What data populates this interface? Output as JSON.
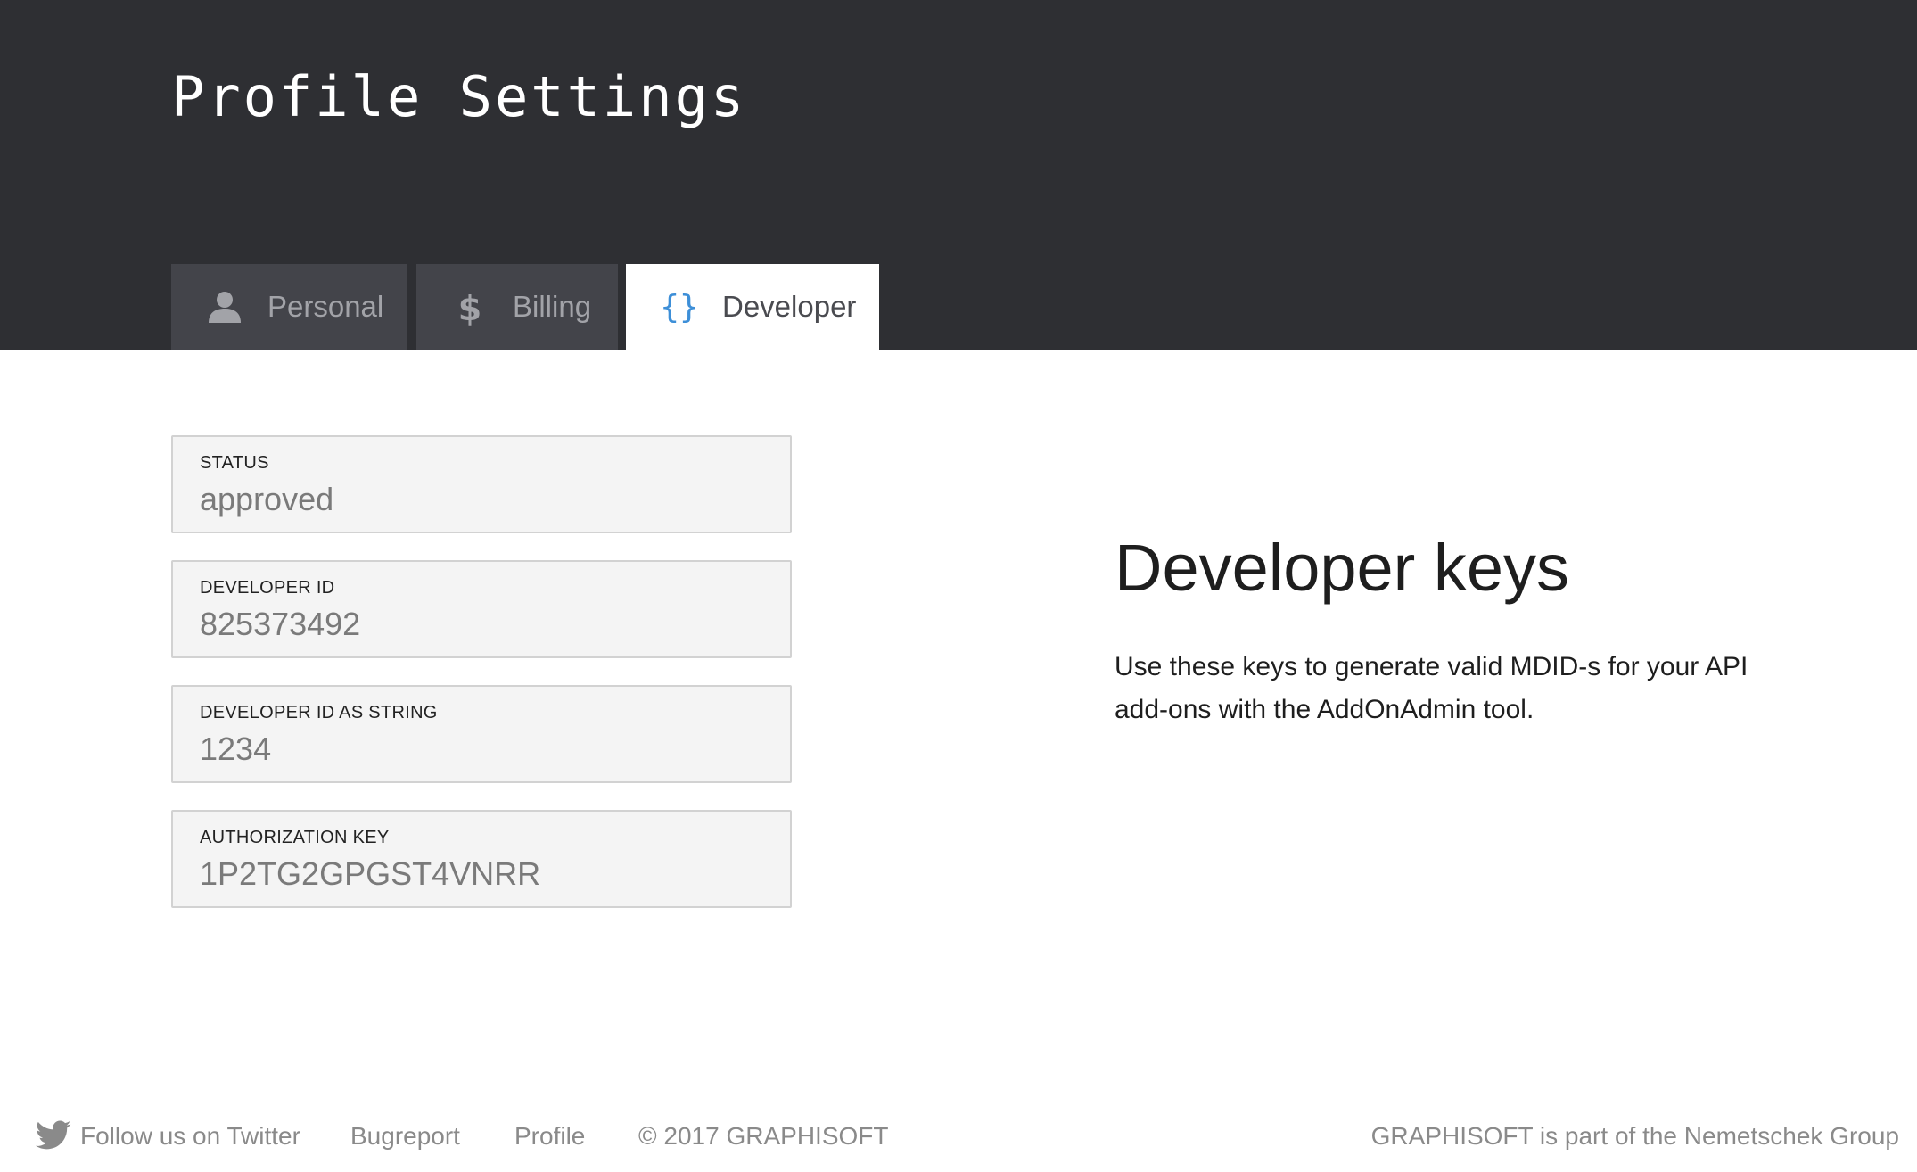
{
  "header": {
    "title": "Profile Settings"
  },
  "tabs": [
    {
      "label": "Personal",
      "icon": "user-icon",
      "active": false
    },
    {
      "label": "Billing",
      "icon": "dollar-icon",
      "active": false
    },
    {
      "label": "Developer",
      "icon": "curly-braces-icon",
      "active": true
    }
  ],
  "fields": [
    {
      "label": "STATUS",
      "value": "approved"
    },
    {
      "label": "DEVELOPER ID",
      "value": "825373492"
    },
    {
      "label": "DEVELOPER ID AS STRING",
      "value": "1234"
    },
    {
      "label": "AUTHORIZATION KEY",
      "value": "1P2TG2GPGST4VNRR"
    }
  ],
  "info": {
    "heading": "Developer keys",
    "text": "Use these keys to generate valid MDID-s for your API add-ons with the AddOnAdmin tool."
  },
  "footer": {
    "twitter": "Follow us on Twitter",
    "bugreport": "Bugreport",
    "profile": "Profile",
    "copyright": "© 2017 GRAPHISOFT",
    "group": "GRAPHISOFT is part of the Nemetschek Group"
  },
  "colors": {
    "header_bg": "#2e2f33",
    "tab_bg": "#43444a",
    "accent": "#3d8fd8",
    "field_bg": "#f4f4f4"
  }
}
